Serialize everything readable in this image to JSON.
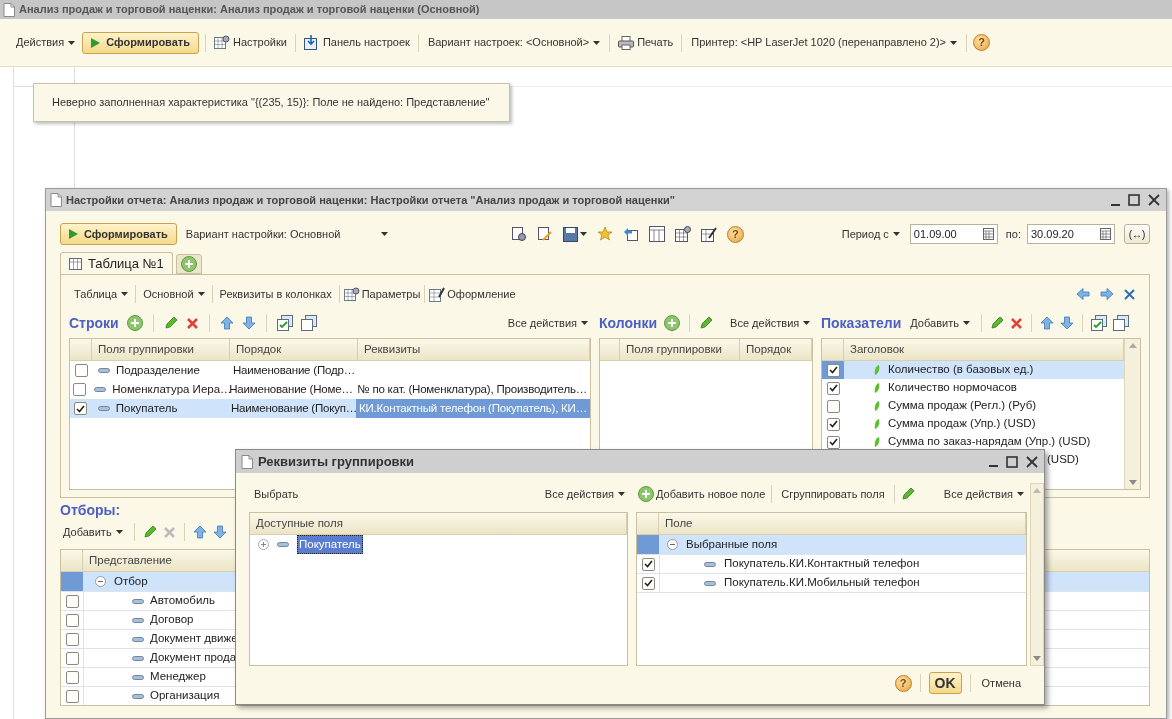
{
  "main_window": {
    "title": "Анализ продаж и торговой наценки: Анализ продаж и торговой наценки (Основной)",
    "toolbar": [
      {
        "kind": "menu",
        "label": "Действия"
      },
      {
        "kind": "primary",
        "label": "Сформировать"
      },
      {
        "kind": "settings",
        "label": "Настройки"
      },
      {
        "kind": "panel",
        "label": "Панель настроек"
      },
      {
        "kind": "menu",
        "label": "Вариант настроек: <Основной>"
      },
      {
        "kind": "print",
        "label": "Печать"
      },
      {
        "kind": "menu",
        "label": "Принтер: <HP LaserJet 1020 (перенаправлено 2)>"
      },
      {
        "kind": "help",
        "label": "?"
      }
    ],
    "error_message": "Неверно заполненная характеристика \"{(235, 15)}: Поле не найдено: Представление\""
  },
  "settings_window": {
    "title": "Настройки отчета: Анализ продаж и торговой наценки: Настройки отчета \"Анализ продаж и торговой наценки\"",
    "generate_button": "Сформировать",
    "variant": "Вариант настройки: Основной",
    "help": "?",
    "period_label": "Период с",
    "date_from": "01.09.00",
    "to_label": "по:",
    "date_to": "30.09.20",
    "period_button": "(↔)",
    "tabs": [
      {
        "label": "Таблица №1",
        "selected": true
      }
    ],
    "panel_toolbar": [
      {
        "kind": "menu",
        "label": "Таблица"
      },
      {
        "kind": "menu",
        "label": "Основной"
      },
      {
        "kind": "plain",
        "label": "Реквизиты в колонках"
      },
      {
        "kind": "params",
        "label": "Параметры"
      },
      {
        "kind": "design",
        "label": "Оформление"
      }
    ],
    "rows_section": {
      "title": "Строки",
      "all_actions": "Все действия",
      "columns": [
        "Поля группировки",
        "Порядок",
        "Реквизиты"
      ],
      "rows": [
        {
          "checked": false,
          "selected": false,
          "field": "Подразделение",
          "order": "Наименование (Подр…"
        },
        {
          "checked": false,
          "selected": false,
          "field": "Номенклатура Иера…",
          "order": "Наименование (Номе…",
          "attributes": "№ по кат. (Номенклатура), Производитель…"
        },
        {
          "checked": true,
          "selected": true,
          "field": "Покупатель",
          "order": "Наименование (Покуп…",
          "attributes": "КИ.Контактный телефон (Покупатель), КИ…"
        }
      ]
    },
    "columns_section": {
      "title": "Колонки",
      "all_actions": "Все действия",
      "columns": [
        "Поля группировки",
        "Порядок"
      ]
    },
    "indicators_section": {
      "title": "Показатели",
      "add": "Добавить",
      "column": "Заголовок",
      "rows": [
        {
          "kind": "full",
          "checked": true,
          "selected": true,
          "label": "Количество (в базовых ед.)"
        },
        {
          "kind": "full",
          "checked": true,
          "selected": false,
          "label": "Количество нормочасов"
        },
        {
          "kind": "full",
          "checked": false,
          "selected": false,
          "label": "Сумма продаж (Регл.) (Руб)"
        },
        {
          "kind": "full",
          "checked": true,
          "selected": false,
          "label": "Сумма продаж (Упр.) (USD)"
        },
        {
          "kind": "full",
          "checked": true,
          "selected": false,
          "label": "Сумма по заказ-нарядам (Упр.) (USD)"
        },
        {
          "kind": "partial",
          "selected": false,
          "label": "(USD)"
        }
      ]
    },
    "filters_section": {
      "title": "Отборы:",
      "add": "Добавить",
      "column": "Представление",
      "group": {
        "label": "Отбор",
        "expanded": true,
        "selected": true
      },
      "rows": [
        {
          "checked": false,
          "label": "Автомобиль"
        },
        {
          "checked": false,
          "label": "Договор"
        },
        {
          "checked": false,
          "label": "Документ движе"
        },
        {
          "checked": false,
          "label": "Документ прода"
        },
        {
          "checked": false,
          "label": "Менеджер"
        },
        {
          "checked": false,
          "label": "Организация"
        }
      ]
    }
  },
  "dialog": {
    "title": "Реквизиты группировки",
    "select": "Выбрать",
    "all_actions_left": "Все действия",
    "add_field": "Добавить новое поле",
    "group_fields": "Сгруппировать поля",
    "all_actions_right": "Все действия",
    "available": {
      "column": "Доступные поля",
      "items": [
        {
          "label": "Покупатель",
          "selected": true,
          "expanded": false
        }
      ]
    },
    "chosen": {
      "column": "Поле",
      "group": {
        "label": "Выбранные поля",
        "expanded": true,
        "selected": true
      },
      "rows": [
        {
          "checked": true,
          "label": "Покупатель.КИ.Контактный телефон"
        },
        {
          "checked": true,
          "label": "Покупатель.КИ.Мобильный телефон"
        }
      ]
    },
    "help": "?",
    "ok": "OK",
    "cancel": "Отмена"
  }
}
